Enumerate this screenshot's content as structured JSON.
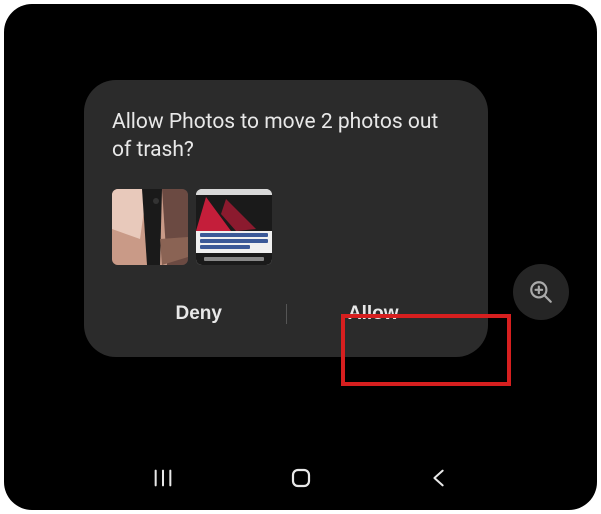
{
  "dialog": {
    "title": "Allow Photos to move 2 photos out of trash?",
    "deny_label": "Deny",
    "allow_label": "Allow"
  },
  "highlight": {
    "target": "allow-button"
  }
}
